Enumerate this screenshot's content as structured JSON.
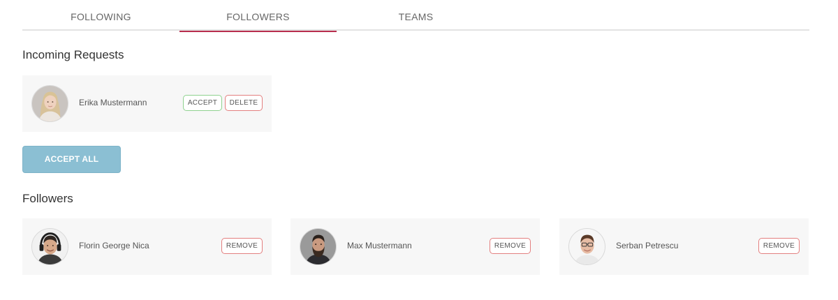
{
  "tabs": [
    {
      "label": "FOLLOWING",
      "active": false
    },
    {
      "label": "FOLLOWERS",
      "active": true
    },
    {
      "label": "TEAMS",
      "active": false
    }
  ],
  "incoming": {
    "title": "Incoming Requests",
    "requests": [
      {
        "name": "Erika Mustermann",
        "accept_label": "ACCEPT",
        "delete_label": "DELETE"
      }
    ],
    "accept_all_label": "ACCEPT ALL"
  },
  "followers": {
    "title": "Followers",
    "items": [
      {
        "name": "Florin George Nica",
        "remove_label": "REMOVE"
      },
      {
        "name": "Max Mustermann",
        "remove_label": "REMOVE"
      },
      {
        "name": "Serban Petrescu",
        "remove_label": "REMOVE"
      }
    ]
  },
  "colors": {
    "active_tab_underline": "#b82e4e",
    "accept_border": "#8fd18f",
    "delete_border": "#e37f7f",
    "accept_all_bg": "#8bbfd3",
    "card_bg": "#f7f7f7"
  },
  "icons": {
    "avatar_erika": "avatar-photo-woman",
    "avatar_florin": "avatar-photo-man-headset",
    "avatar_max": "avatar-photo-man-beard",
    "avatar_serban": "avatar-photo-man-glasses"
  }
}
